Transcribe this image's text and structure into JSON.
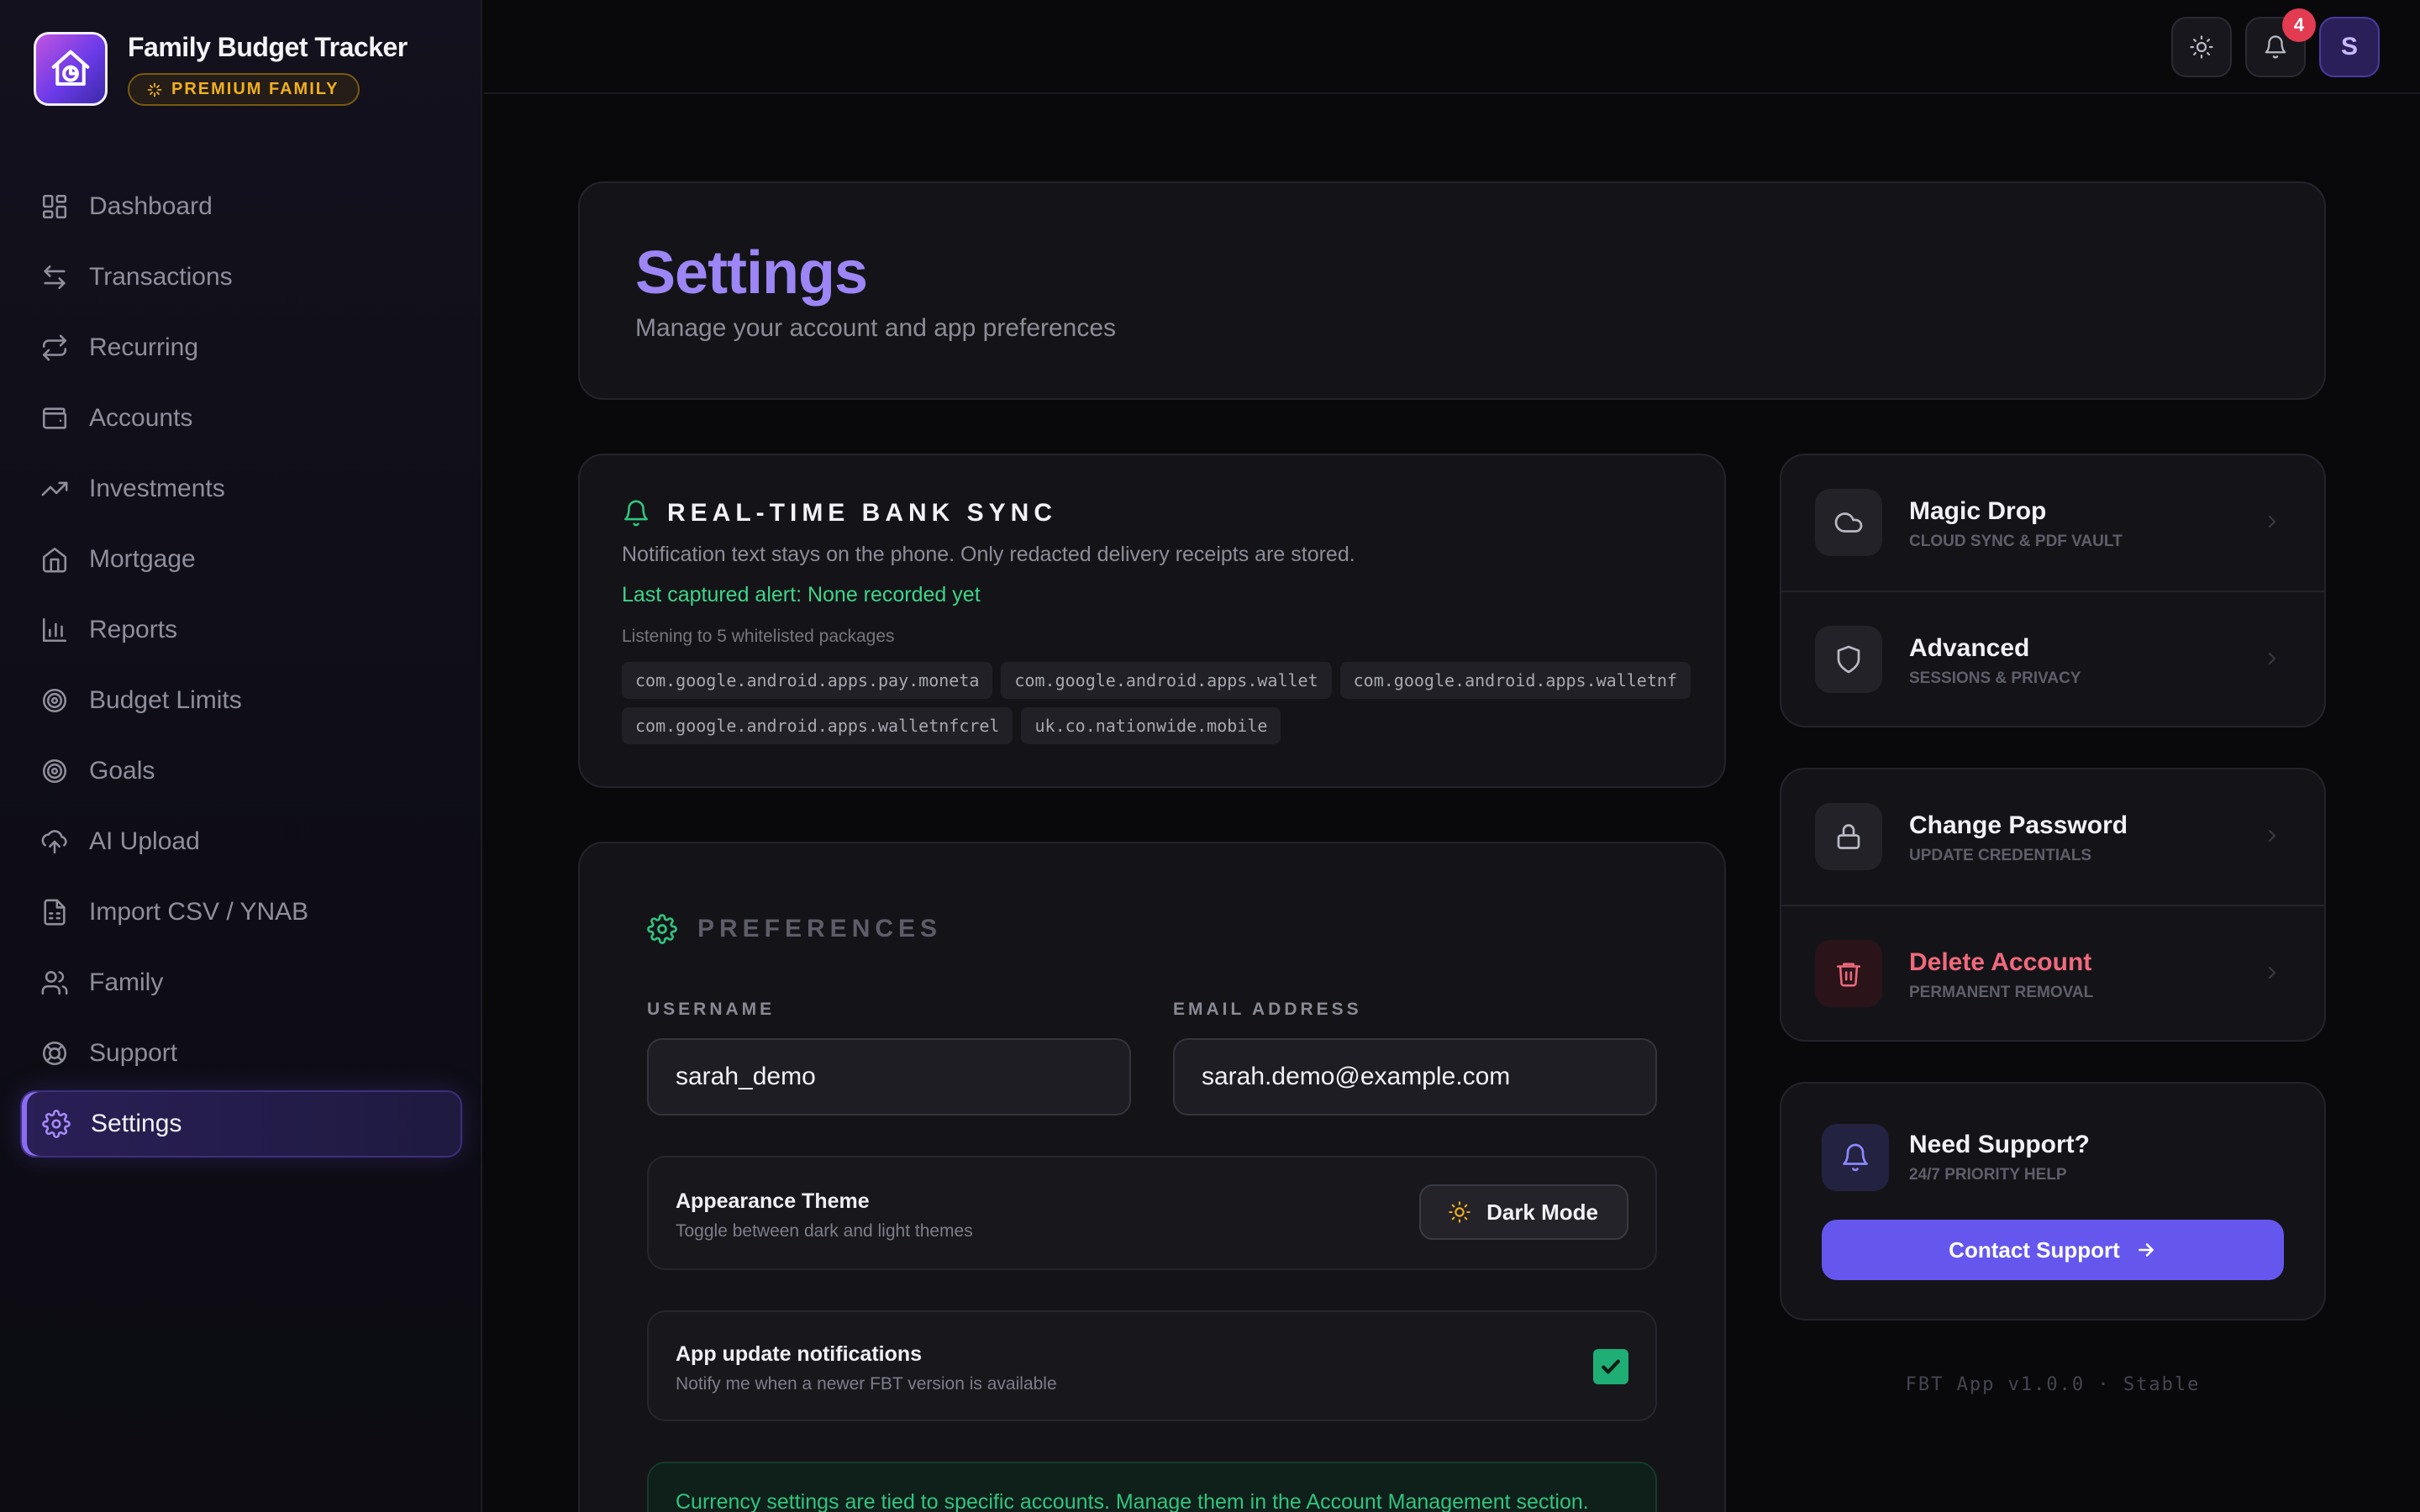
{
  "app": {
    "title": "Family Budget Tracker",
    "badge": "PREMIUM FAMILY"
  },
  "sidebar": {
    "items": [
      {
        "label": "Dashboard",
        "icon": "grid-icon"
      },
      {
        "label": "Transactions",
        "icon": "arrows-left-right-icon"
      },
      {
        "label": "Recurring",
        "icon": "repeat-icon"
      },
      {
        "label": "Accounts",
        "icon": "wallet-icon"
      },
      {
        "label": "Investments",
        "icon": "trending-up-icon"
      },
      {
        "label": "Mortgage",
        "icon": "home-icon"
      },
      {
        "label": "Reports",
        "icon": "bar-chart-icon"
      },
      {
        "label": "Budget Limits",
        "icon": "target-icon"
      },
      {
        "label": "Goals",
        "icon": "target-icon"
      },
      {
        "label": "AI Upload",
        "icon": "cloud-upload-icon"
      },
      {
        "label": "Import CSV / YNAB",
        "icon": "file-spreadsheet-icon"
      },
      {
        "label": "Family",
        "icon": "users-icon"
      },
      {
        "label": "Support",
        "icon": "life-buoy-icon"
      },
      {
        "label": "Settings",
        "icon": "gear-icon",
        "active": true
      }
    ]
  },
  "topbar": {
    "notification_count": "4",
    "avatar_initial": "S"
  },
  "header": {
    "title": "Settings",
    "subtitle": "Manage your account and app preferences"
  },
  "sync": {
    "title": "REAL-TIME BANK SYNC",
    "description": "Notification text stays on the phone. Only redacted delivery receipts are stored.",
    "last_alert": "Last captured alert: None recorded yet",
    "listening": "Listening to 5 whitelisted packages",
    "packages": [
      "com.google.android.apps.pay.moneta",
      "com.google.android.apps.wallet",
      "com.google.android.apps.walletnf",
      "com.google.android.apps.walletnfcrel",
      "uk.co.nationwide.mobile"
    ]
  },
  "preferences": {
    "title": "PREFERENCES",
    "username_label": "USERNAME",
    "username_value": "sarah_demo",
    "email_label": "EMAIL ADDRESS",
    "email_value": "sarah.demo@example.com",
    "theme_title": "Appearance Theme",
    "theme_sub": "Toggle between dark and light themes",
    "theme_button": "Dark Mode",
    "updates_title": "App update notifications",
    "updates_sub": "Notify me when a newer FBT version is available",
    "updates_checked": true,
    "currency_note": "Currency settings are tied to specific accounts. Manage them in the Account Management section."
  },
  "quick_links": {
    "magic_drop_title": "Magic Drop",
    "magic_drop_sub": "CLOUD SYNC & PDF VAULT",
    "advanced_title": "Advanced",
    "advanced_sub": "SESSIONS & PRIVACY",
    "password_title": "Change Password",
    "password_sub": "UPDATE CREDENTIALS",
    "delete_title": "Delete Account",
    "delete_sub": "PERMANENT REMOVAL"
  },
  "support": {
    "title": "Need Support?",
    "subtitle": "24/7 PRIORITY HELP",
    "button": "Contact Support"
  },
  "version": "FBT App v1.0.0 · Stable",
  "colors": {
    "accent": "#6557ee",
    "title_purple": "#9c85f5",
    "success": "#31c47f",
    "danger": "#f0697d",
    "gold": "#f2b01e"
  }
}
